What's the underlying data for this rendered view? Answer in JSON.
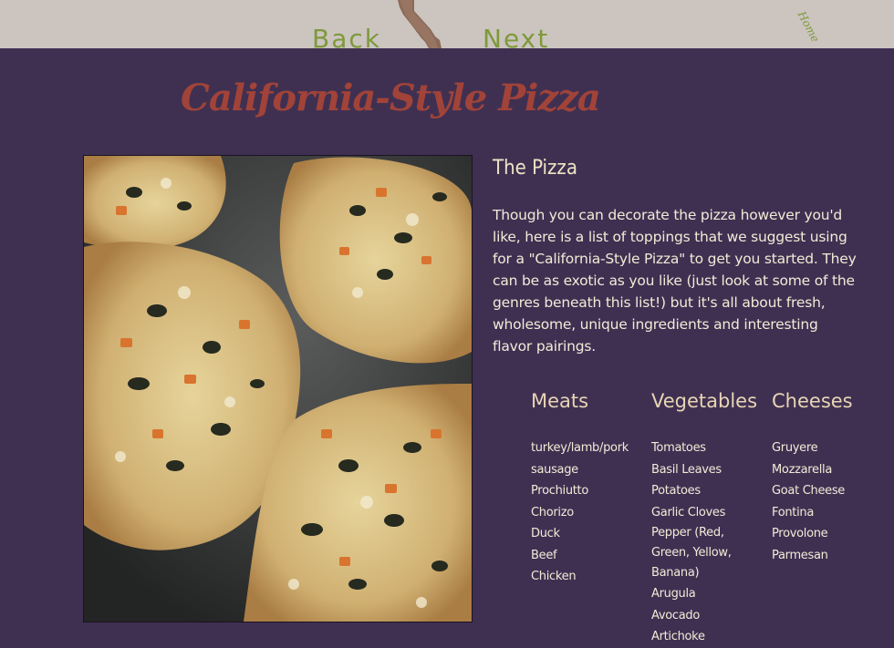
{
  "nav": {
    "back_label": "Back",
    "next_label": "Next",
    "home_label": "Home"
  },
  "page_title": "California-Style Pizza",
  "section": {
    "heading": "The Pizza",
    "intro": "Though you can decorate the pizza however you'd like, here is a list of toppings that we suggest using for a \"California-Style Pizza\" to get you started. They can be as exotic as you like (just look at some of the genres beneath this list!) but it's all about fresh, wholesome, unique ingredients and interesting flavor pairings."
  },
  "toppings": {
    "meats": {
      "heading": "Meats",
      "items": [
        "turkey/lamb/pork sausage",
        "Prochiutto",
        "Chorizo",
        "Duck",
        "Beef",
        "Chicken"
      ]
    },
    "vegetables": {
      "heading": "Vegetables",
      "items": [
        "Tomatoes",
        "Basil Leaves",
        "Potatoes",
        "Garlic Cloves",
        "Pepper (Red, Green, Yellow, Banana)",
        "Arugula",
        "Avocado",
        "Artichoke"
      ]
    },
    "cheeses": {
      "heading": "Cheeses",
      "items": [
        "Gruyere",
        "Mozzarella",
        "Goat Cheese",
        "Fontina",
        "Provolone",
        "Parmesan"
      ]
    }
  },
  "colors": {
    "background": "#3f3052",
    "topbar": "#ccc4bf",
    "nav_text": "#7d9a3a",
    "title": "#a14338",
    "body_text": "#f4ead6"
  }
}
